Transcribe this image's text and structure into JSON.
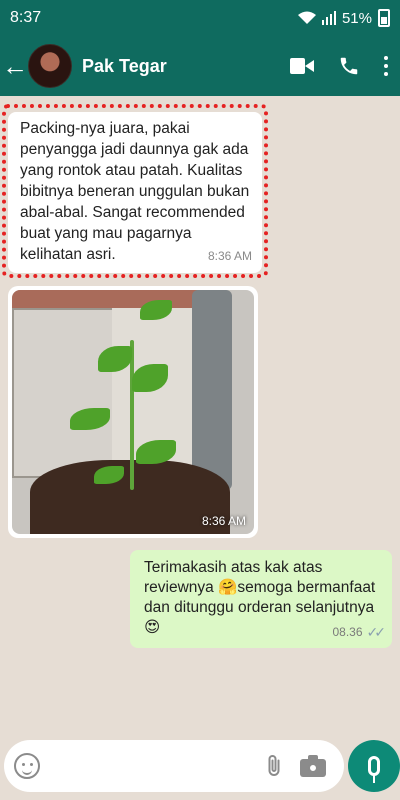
{
  "status_bar": {
    "time": "8:37",
    "battery": "51%"
  },
  "header": {
    "contact_name": "Pak Tegar"
  },
  "messages": [
    {
      "text": "Packing-nya juara, pakai penyangga jadi daunnya gak ada yang rontok atau patah. Kualitas bibitnya beneran unggulan bukan abal-abal. Sangat recommended buat yang mau pagarnya kelihatan asri.",
      "time": "8:36 AM"
    },
    {
      "type": "image",
      "time": "8:36 AM"
    },
    {
      "text": "Terimakasih atas kak atas reviewnya 🤗semoga bermanfaat dan ditunggu orderan selanjutnya😍",
      "time": "08.36"
    }
  ],
  "colors": {
    "header": "#0f6b5f",
    "outgoing_bubble": "#dcf8c6",
    "chat_bg": "#e6ddd4",
    "highlight": "#e52222"
  },
  "icons": [
    "back-arrow-icon",
    "video-call-icon",
    "phone-icon",
    "more-options-icon",
    "emoji-icon",
    "attachment-icon",
    "camera-icon",
    "mic-icon",
    "read-receipt-icon"
  ]
}
